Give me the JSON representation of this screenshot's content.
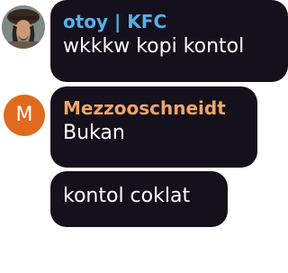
{
  "colors": {
    "bubble_bg": "#14111c",
    "message_text": "#ffffff",
    "sender_1": "#5aaee8",
    "sender_2": "#f0a56a",
    "avatar_letter_bg": "#e0691e"
  },
  "messages": [
    {
      "sender": "otoy | KFC",
      "text": "wkkkw kopi kontol",
      "avatar": {
        "type": "photo",
        "icon": "user-photo-icon"
      }
    },
    {
      "sender": "Mezzooschneidt",
      "text": "Bukan",
      "avatar": {
        "type": "letter",
        "letter": "M"
      }
    },
    {
      "text": "kontol coklat"
    }
  ]
}
